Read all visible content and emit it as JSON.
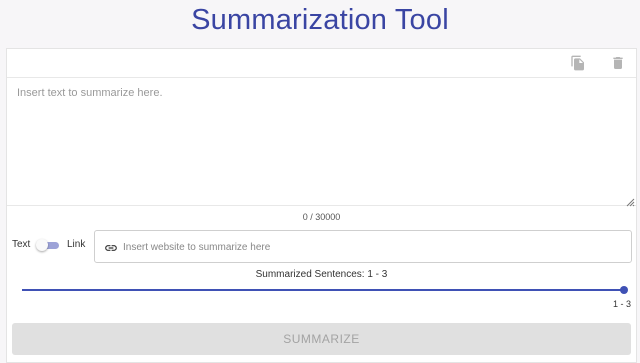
{
  "header": {
    "title": "Summarization Tool"
  },
  "toolbar": {
    "copy_icon": "copy-icon",
    "delete_icon": "trash-icon"
  },
  "editor": {
    "placeholder": "Insert text to summarize here.",
    "value": "",
    "char_count": "0 / 30000"
  },
  "mode": {
    "text_label": "Text",
    "link_label": "Link",
    "selected": "text"
  },
  "link_input": {
    "icon": "link-icon",
    "placeholder": "Insert website to summarize here",
    "value": ""
  },
  "sentences": {
    "label": "Summarized Sentences: 1 - 3",
    "slider_min": 1,
    "slider_max": 3,
    "slider_value": 3,
    "value_label": "1 - 3"
  },
  "summarize_button": {
    "label": "SUMMARIZE"
  },
  "colors": {
    "accent": "#3f51b5",
    "title": "#3a45a3",
    "button_disabled_bg": "#e0e0e0",
    "button_disabled_text": "#a3a3a3"
  }
}
